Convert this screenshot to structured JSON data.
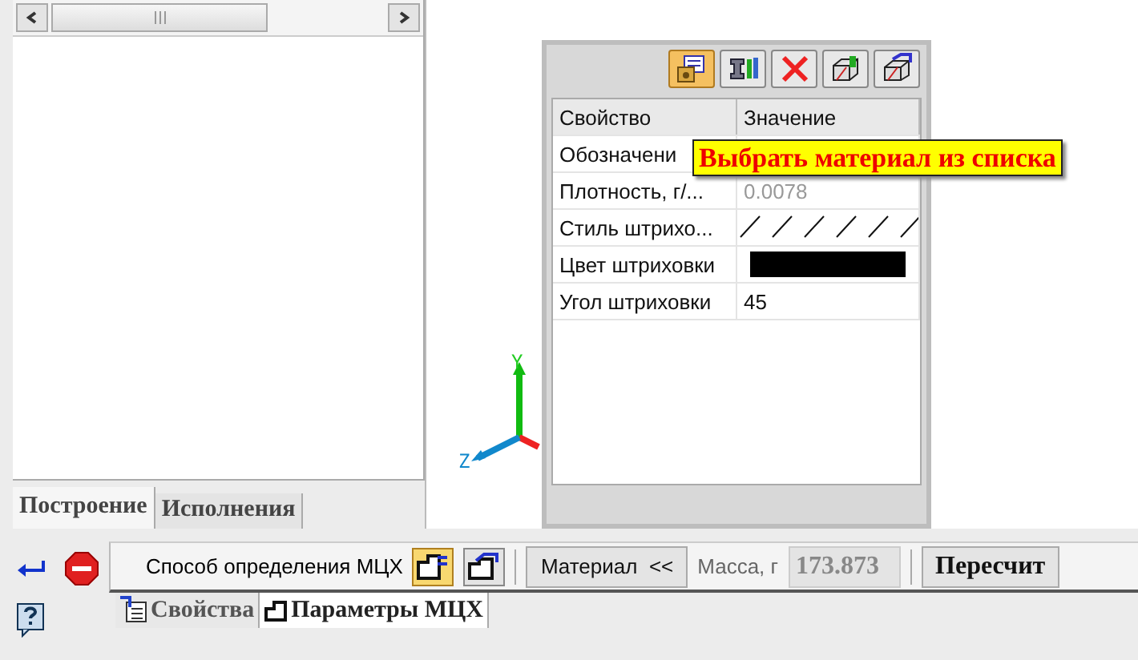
{
  "left_panel": {
    "tabs": [
      {
        "label": "Построение",
        "selected": true
      },
      {
        "label": "Исполнения",
        "selected": false
      }
    ]
  },
  "canvas": {
    "axis_labels": [
      "Y",
      "Z"
    ]
  },
  "properties_panel": {
    "toolbar_buttons": [
      {
        "highlighted": true
      },
      {
        "highlighted": false
      },
      {
        "highlighted": false
      },
      {
        "highlighted": false
      },
      {
        "highlighted": false
      }
    ],
    "columns": [
      "Свойство",
      "Значение"
    ],
    "rows": [
      {
        "kind": "text",
        "name": "Обозначени"
      },
      {
        "kind": "text",
        "name": "Плотность, г/...",
        "value": "0.0078",
        "disabled": true
      },
      {
        "kind": "hatch",
        "name": "Стиль штрихо..."
      },
      {
        "kind": "color",
        "name": "Цвет штриховки",
        "color": "#000000"
      },
      {
        "kind": "text",
        "name": "Угол штриховки",
        "value": "45",
        "disabled": false
      }
    ],
    "tooltip": "Выбрать материал из списка"
  },
  "bottom_bar": {
    "method_label": "Способ определения МЦХ",
    "method_buttons": [
      {
        "selected": true
      },
      {
        "selected": false
      }
    ],
    "material_button": "Материал  <<",
    "mass_label": "Масса, г",
    "mass_value": "173.873",
    "recalc_button": "Пересчит"
  },
  "bottom_tabs": [
    {
      "label": "Свойства",
      "selected": false
    },
    {
      "label": "Параметры МЦХ",
      "selected": true
    }
  ]
}
